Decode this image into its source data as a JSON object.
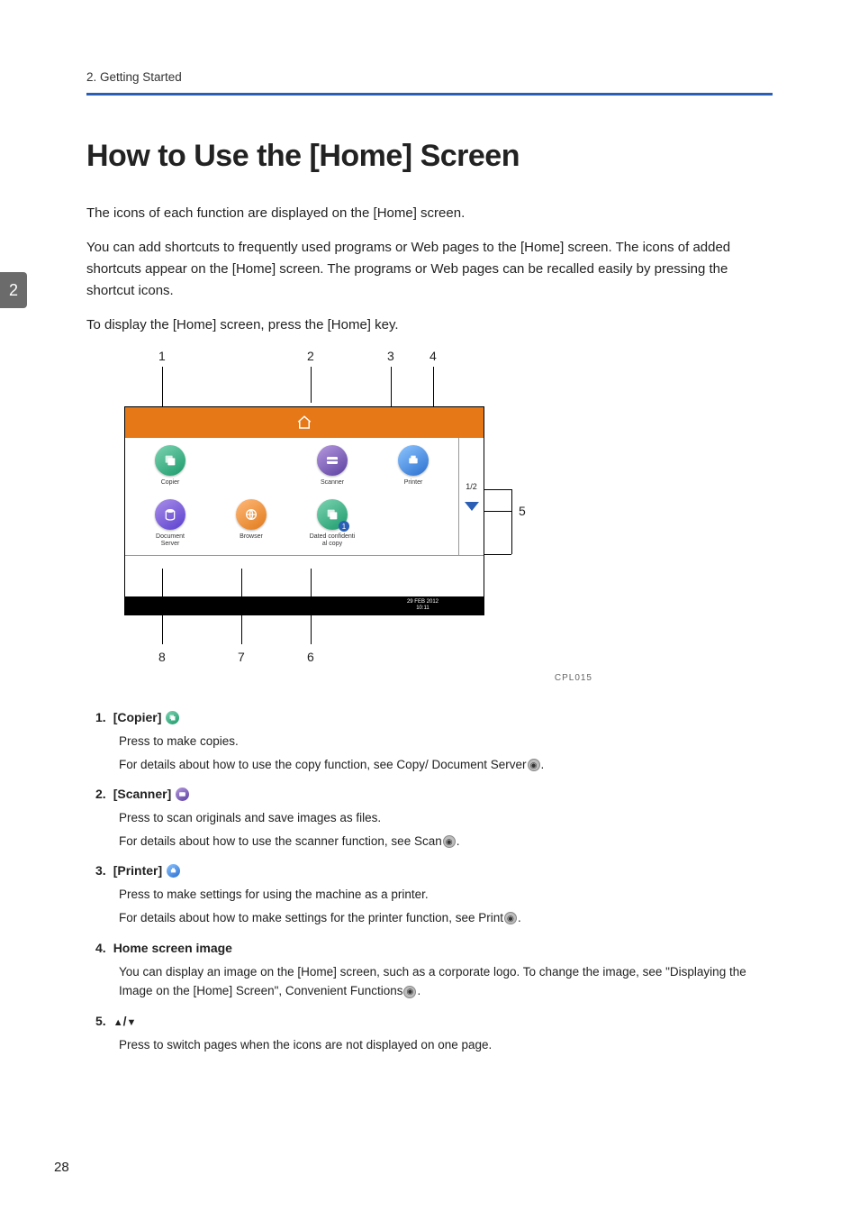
{
  "header": {
    "running_head": "2. Getting Started",
    "title": "How to Use the [Home] Screen"
  },
  "chapter_tab": "2",
  "intro": {
    "p1": "The icons of each function are displayed on the [Home] screen.",
    "p2": "You can add shortcuts to frequently used programs or Web pages to the [Home] screen. The icons of added shortcuts appear on the [Home] screen. The programs or Web pages can be recalled easily by pressing the shortcut icons.",
    "p3": "To display the [Home] screen, press the [Home] key."
  },
  "figure": {
    "callouts_top": {
      "c1": "1",
      "c2": "2",
      "c3": "3",
      "c4": "4"
    },
    "callouts_bottom": {
      "c6": "6",
      "c7": "7",
      "c8": "8"
    },
    "callout_side": "5",
    "pager": "1/2",
    "icons": {
      "copier": "Copier",
      "scanner": "Scanner",
      "printer": "Printer",
      "docserver_l1": "Document",
      "docserver_l2": "Server",
      "browser": "Browser",
      "dated_l1": "Dated confidenti",
      "dated_l2": "al copy"
    },
    "datetime_l1": "29 FEB  2012",
    "datetime_l2": "10:11",
    "code": "CPL015"
  },
  "list": {
    "i1": {
      "num": "1.",
      "title": "[Copier]",
      "d1": "Press to make copies.",
      "d2a": "For details about how to use the copy function, see Copy/ Document Server",
      "d2b": "."
    },
    "i2": {
      "num": "2.",
      "title": "[Scanner]",
      "d1": "Press to scan originals and save images as files.",
      "d2a": "For details about how to use the scanner function, see Scan",
      "d2b": "."
    },
    "i3": {
      "num": "3.",
      "title": "[Printer]",
      "d1": "Press to make settings for using the machine as a printer.",
      "d2a": "For details about how to make settings for the printer function, see Print",
      "d2b": "."
    },
    "i4": {
      "num": "4.",
      "title": "Home screen image",
      "d1a": "You can display an image on the [Home] screen, such as a corporate logo. To change the image, see \"Displaying the Image on the [Home] Screen\", Convenient Functions",
      "d1b": "."
    },
    "i5": {
      "num": "5.",
      "title_a": "▲",
      "title_sep": "/",
      "title_b": "▼",
      "d1": "Press to switch pages when the icons are not displayed on one page."
    }
  },
  "page_number": "28"
}
